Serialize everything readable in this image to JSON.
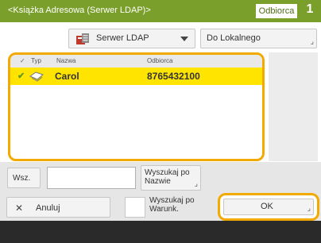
{
  "header": {
    "title": "<Książka Adresowa (Serwer LDAP)>",
    "destination_label": "Odbiorca",
    "destination_count": "1"
  },
  "ldap_selector": {
    "selected": "Serwer LDAP",
    "icon": "server-book-icon"
  },
  "local_button": {
    "label": "Do Lokalnego"
  },
  "list": {
    "columns": {
      "typ": "Typ",
      "nazwa": "Nazwa",
      "odbiorca": "Odbiorca"
    },
    "rows": [
      {
        "name": "Carol",
        "number": "8765432100",
        "selected": true,
        "type_icon": "fax-icon"
      }
    ]
  },
  "search": {
    "wsz_label": "Wsz.",
    "input_value": "",
    "search_by_name_label": "Wyszukaj po Nazwie"
  },
  "bottom": {
    "cancel_label": "Anuluj",
    "search_by_condition_label": "Wyszukaj po Warunk.",
    "ok_label": "OK"
  },
  "colors": {
    "header_green": "#7a9f2a",
    "highlight_orange": "#f2a900",
    "selected_row_yellow": "#ffe400"
  }
}
